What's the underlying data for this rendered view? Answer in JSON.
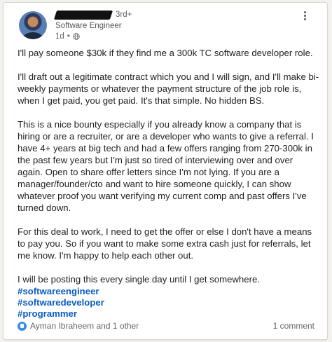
{
  "post": {
    "author": {
      "connection_degree": "3rd+",
      "headline": "Software Engineer",
      "time": "1d",
      "visibility_icon": "globe-icon"
    },
    "more_icon": "more-options-icon",
    "paragraphs": [
      "I'll pay someone $30k if they find me a 300k TC software developer role.",
      "I'll draft out a legitimate contract which you and I will sign, and I'll make bi-weekly payments or whatever the payment structure of the job role is, when I get paid, you get paid. It's that simple. No hidden BS.",
      "This is a nice bounty especially if you already know a company that is hiring or are a recruiter, or are a developer who wants to give a referral. I have 4+ years at big tech and had a few offers ranging from 270-300k in the past few years but I'm just so tired of interviewing over and over again. Open to share offer letters since I'm not lying. If you are a manager/founder/cto and want to hire someone quickly, I can show whatever proof you want verifying my current comp and past offers I've turned down.",
      "For this deal to work, I need to get the offer or else I don't have a means to pay you. So if you want to make some extra cash just for referrals, let me know. I'm happy to help each other out.",
      "I will be posting this every single day until I get somewhere."
    ],
    "hashtags": [
      "#softwareengineer",
      "#softwaredeveloper",
      "#programmer"
    ],
    "reactions_text": "Ayman Ibraheem and 1 other",
    "comments_text": "1 comment"
  }
}
